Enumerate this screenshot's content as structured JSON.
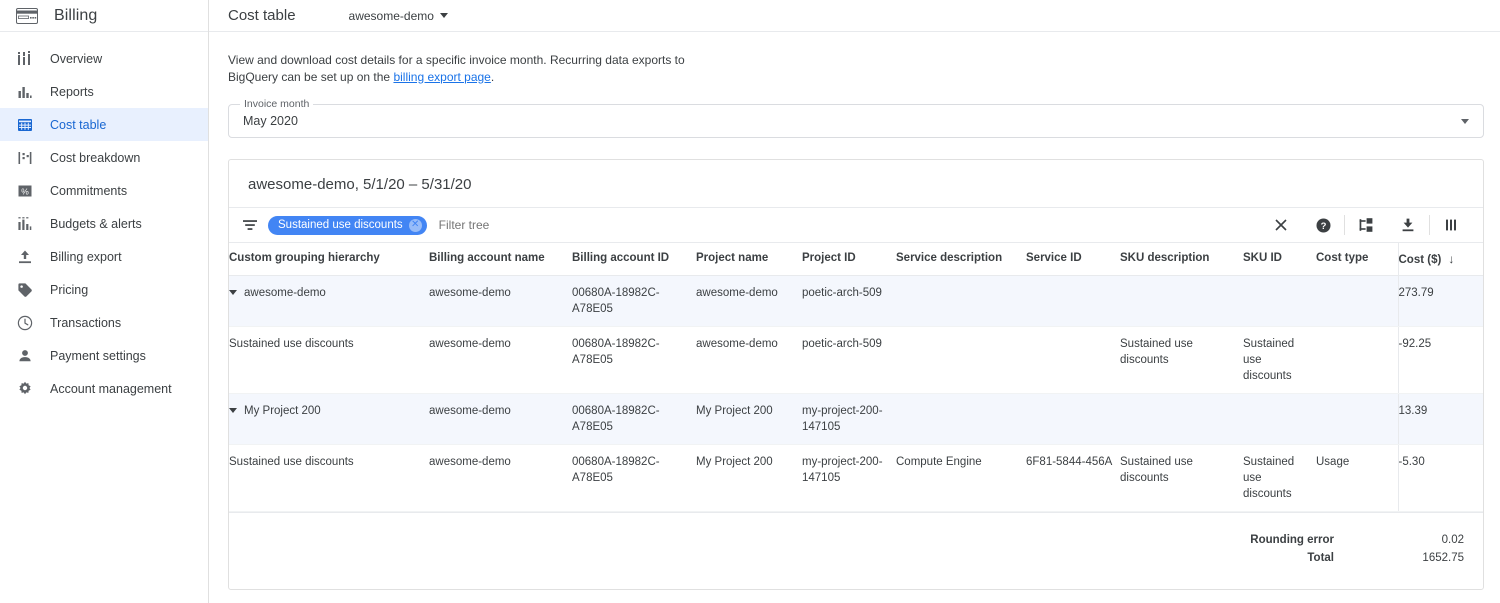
{
  "sidebar": {
    "brand": "Billing",
    "brand_icon": "credit-card-icon",
    "items": [
      {
        "label": "Overview",
        "icon": "dashboard-icon"
      },
      {
        "label": "Reports",
        "icon": "bar-chart-icon"
      },
      {
        "label": "Cost table",
        "icon": "grid-table-icon",
        "active": true
      },
      {
        "label": "Cost breakdown",
        "icon": "waterfall-chart-icon"
      },
      {
        "label": "Commitments",
        "icon": "percent-icon"
      },
      {
        "label": "Budgets & alerts",
        "icon": "budget-bars-icon"
      },
      {
        "label": "Billing export",
        "icon": "upload-icon"
      },
      {
        "label": "Pricing",
        "icon": "tag-icon"
      },
      {
        "label": "Transactions",
        "icon": "clock-icon"
      },
      {
        "label": "Payment settings",
        "icon": "person-icon"
      },
      {
        "label": "Account management",
        "icon": "gear-icon"
      }
    ]
  },
  "header": {
    "title": "Cost table",
    "project_selector": "awesome-demo",
    "project_selector_icon": "chevron-down-icon"
  },
  "description": {
    "line1": "View and download cost details for a specific invoice month. Recurring data exports to",
    "line2_prefix": "BigQuery can be set up on the ",
    "link": "billing export page",
    "line2_suffix": "."
  },
  "invoice_month": {
    "label": "Invoice month",
    "value": "May 2020",
    "icon": "chevron-down-icon"
  },
  "card": {
    "title": "awesome-demo, 5/1/20 – 5/31/20"
  },
  "toolbar": {
    "filter_icon": "filter-list-icon",
    "chip_label": "Sustained use discounts",
    "chip_remove_icon": "close-circle-icon",
    "filter_placeholder": "Filter tree",
    "actions": [
      {
        "name": "clear-filters-button",
        "icon": "close-icon"
      },
      {
        "name": "help-button",
        "icon": "help-circle-icon"
      },
      {
        "name": "expand-tree-button",
        "icon": "tree-expand-icon"
      },
      {
        "name": "download-button",
        "icon": "download-icon"
      },
      {
        "name": "columns-button",
        "icon": "columns-icon"
      }
    ]
  },
  "table": {
    "columns": [
      "Custom grouping hierarchy",
      "Billing account name",
      "Billing account ID",
      "Project name",
      "Project ID",
      "Service description",
      "Service ID",
      "SKU description",
      "SKU ID",
      "Cost type",
      "Cost ($)"
    ],
    "sort_column": "Cost ($)",
    "sort_icon": "arrow-down-icon",
    "rows": [
      {
        "type": "group",
        "expander_icon": "triangle-down-icon",
        "hierarchy": "awesome-demo",
        "billing_account_name": "awesome-demo",
        "billing_account_id": "00680A-18982C-A78E05",
        "project_name": "awesome-demo",
        "project_id": "poetic-arch-509",
        "service_description": "",
        "service_id": "",
        "sku_description": "",
        "sku_id": "",
        "cost_type": "",
        "cost": "273.79"
      },
      {
        "type": "child",
        "hierarchy": "Sustained use discounts",
        "billing_account_name": "awesome-demo",
        "billing_account_id": "00680A-18982C-A78E05",
        "project_name": "awesome-demo",
        "project_id": "poetic-arch-509",
        "service_description": "",
        "service_id": "",
        "sku_description": "Sustained use discounts",
        "sku_id": "Sustained use discounts",
        "cost_type": "",
        "cost": "-92.25"
      },
      {
        "type": "group",
        "expander_icon": "triangle-down-icon",
        "hierarchy": "My Project 200",
        "billing_account_name": "awesome-demo",
        "billing_account_id": "00680A-18982C-A78E05",
        "project_name": "My Project 200",
        "project_id": "my-project-200-147105",
        "service_description": "",
        "service_id": "",
        "sku_description": "",
        "sku_id": "",
        "cost_type": "",
        "cost": "13.39"
      },
      {
        "type": "child",
        "hierarchy": "Sustained use discounts",
        "billing_account_name": "awesome-demo",
        "billing_account_id": "00680A-18982C-A78E05",
        "project_name": "My Project 200",
        "project_id": "my-project-200-147105",
        "service_description": "Compute Engine",
        "service_id": "6F81-5844-456A",
        "sku_description": "Sustained use discounts",
        "sku_id": "Sustained use discounts",
        "cost_type": "Usage",
        "cost": "-5.30"
      }
    ]
  },
  "totals": {
    "rounding_error_label": "Rounding error",
    "rounding_error_value": "0.02",
    "total_label": "Total",
    "total_value": "1652.75"
  },
  "colors": {
    "accent": "#1a73e8",
    "chip": "#4285f4",
    "active_nav_bg": "#e8f0fe",
    "group_row_bg": "#f4f7fd"
  }
}
